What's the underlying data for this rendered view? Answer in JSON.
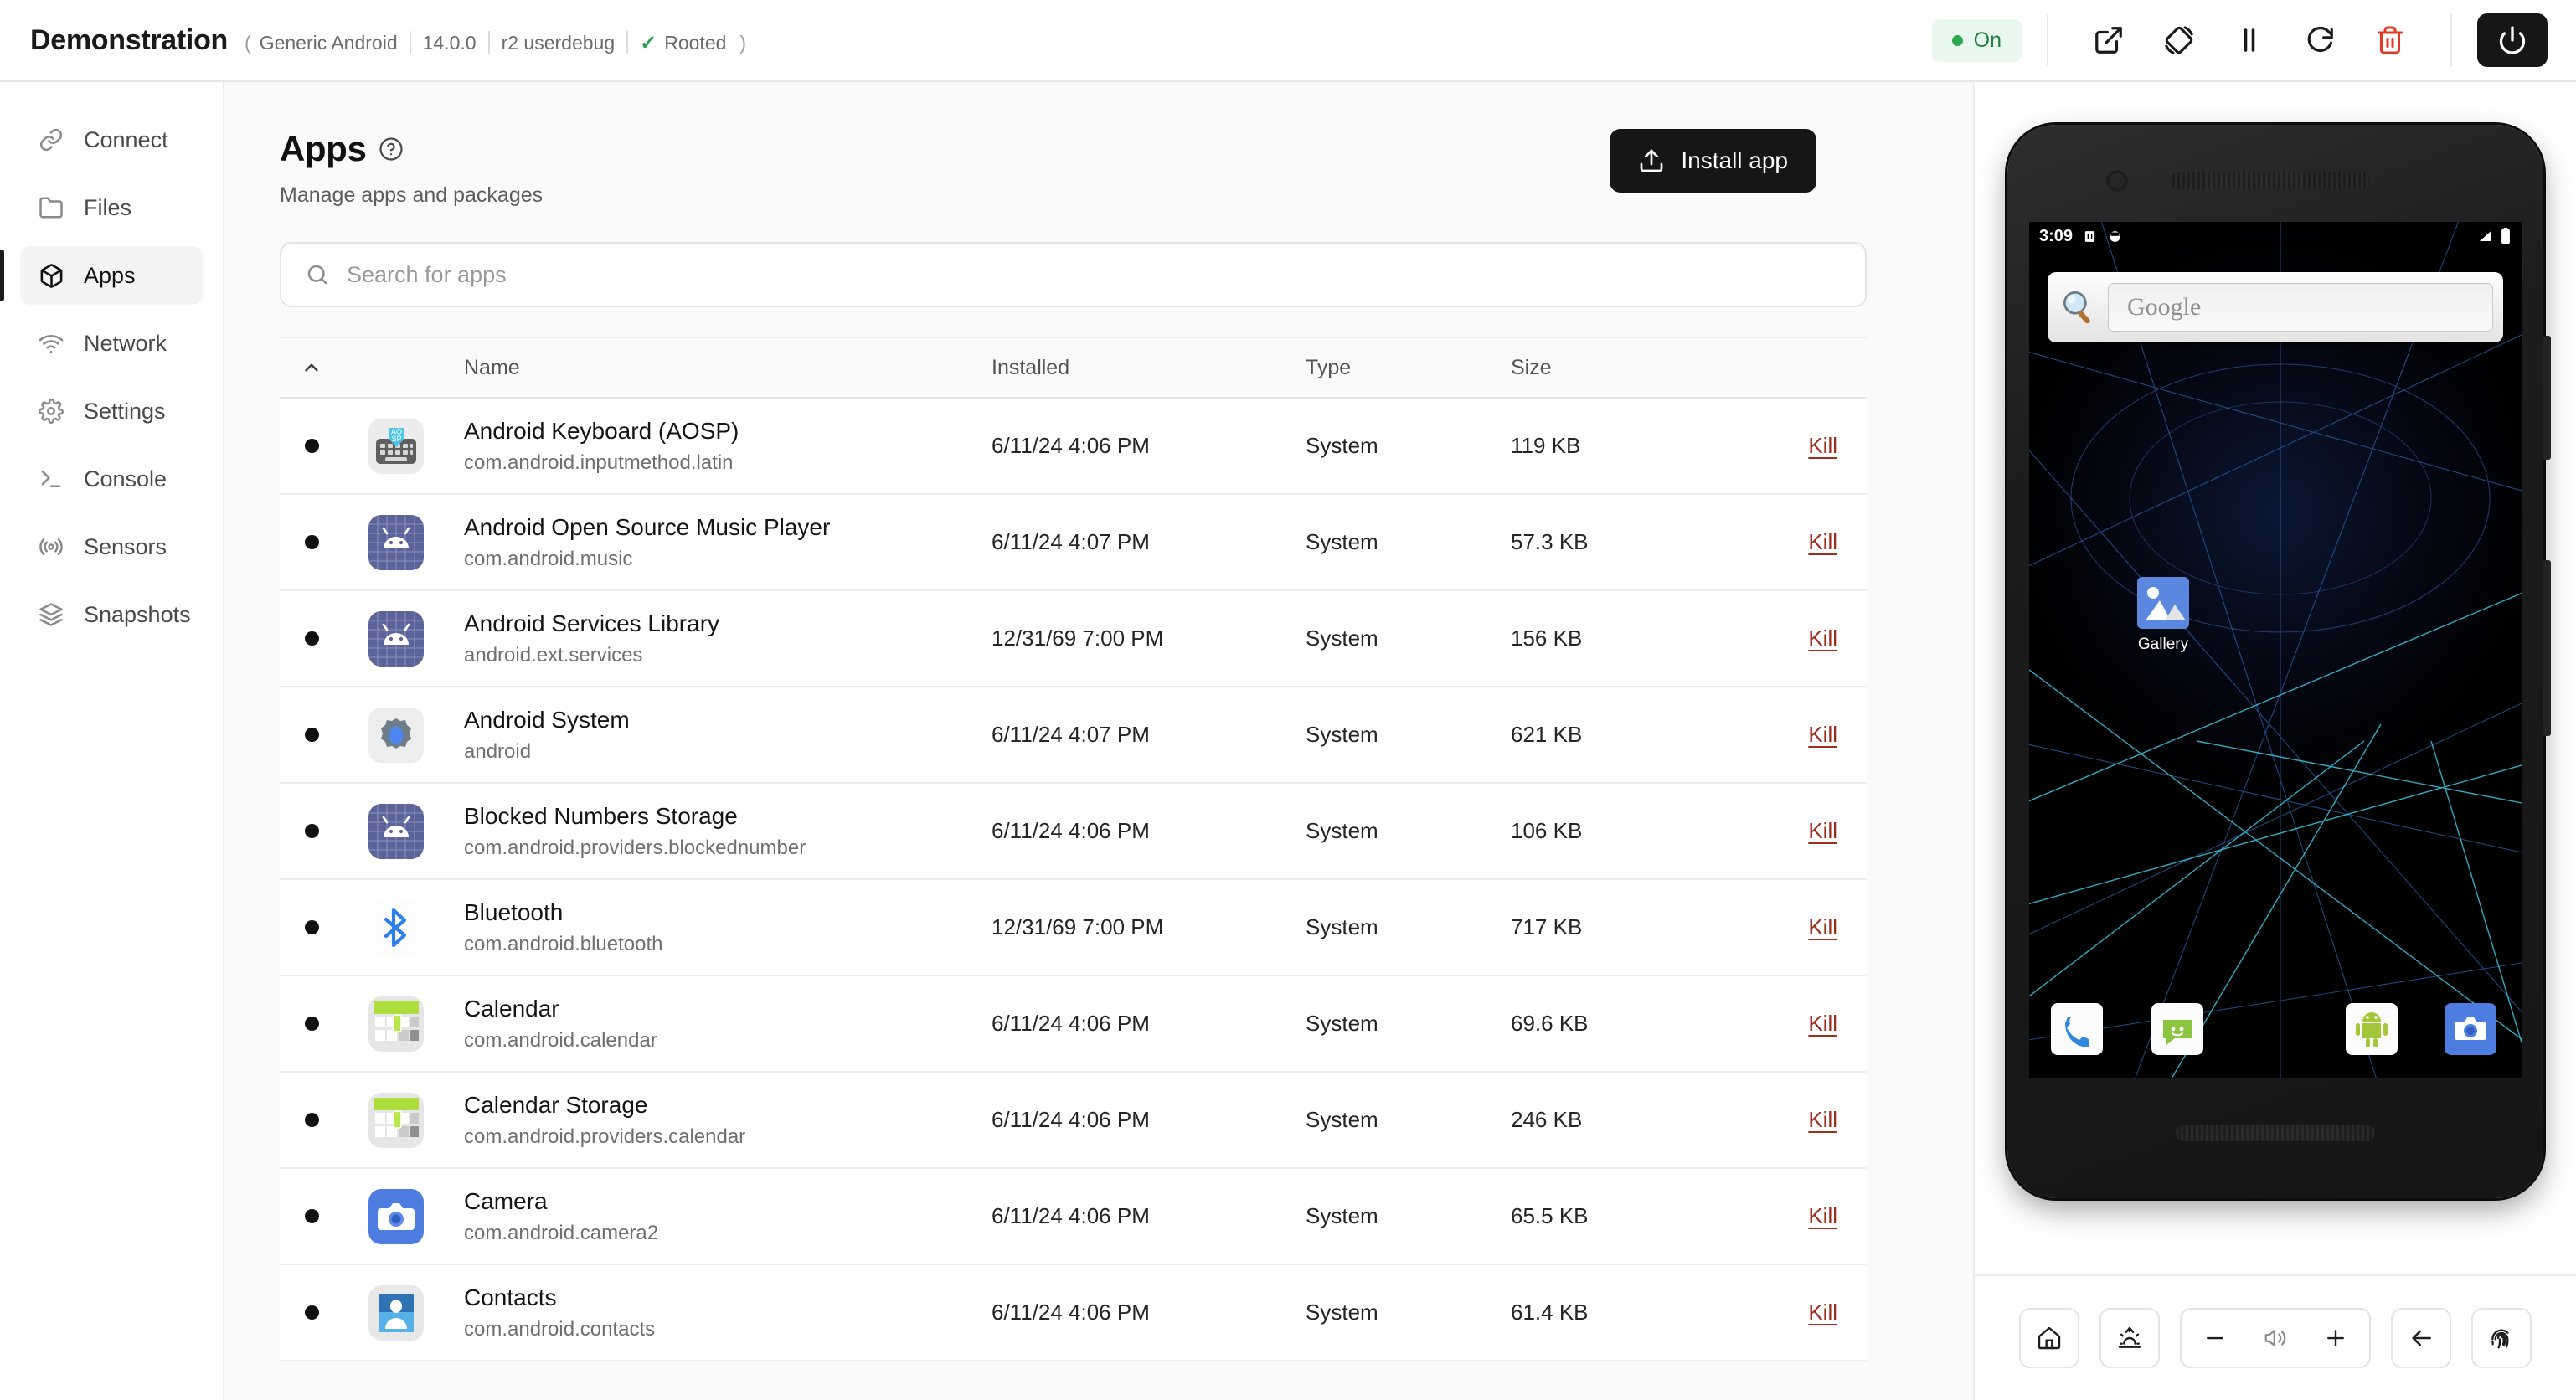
{
  "header": {
    "title": "Demonstration",
    "device": "Generic Android",
    "version": "14.0.0",
    "build": "r2 userdebug",
    "root_status": "Rooted",
    "root_check": "✓",
    "paren_open": "(",
    "paren_close": ")",
    "status_pill": "On",
    "actions": [
      {
        "name": "open-external-button",
        "label": "Open external"
      },
      {
        "name": "rotate-device-button",
        "label": "Rotate"
      },
      {
        "name": "pause-button",
        "label": "Pause"
      },
      {
        "name": "restart-button",
        "label": "Restart"
      },
      {
        "name": "delete-button",
        "label": "Delete"
      }
    ],
    "power_label": "Power",
    "colors": {
      "accent_green": "#2fa84f",
      "danger_red": "#e03a23",
      "dark": "#161616"
    }
  },
  "sidebar": {
    "items": [
      {
        "label": "Connect",
        "icon": "link-icon",
        "active": false
      },
      {
        "label": "Files",
        "icon": "folder-icon",
        "active": false
      },
      {
        "label": "Apps",
        "icon": "box-icon",
        "active": true
      },
      {
        "label": "Network",
        "icon": "wifi-icon",
        "active": false
      },
      {
        "label": "Settings",
        "icon": "gear-icon",
        "active": false
      },
      {
        "label": "Console",
        "icon": "terminal-icon",
        "active": false
      },
      {
        "label": "Sensors",
        "icon": "sensor-icon",
        "active": false
      },
      {
        "label": "Snapshots",
        "icon": "layers-icon",
        "active": false
      }
    ]
  },
  "page": {
    "title": "Apps",
    "subtitle": "Manage apps and packages",
    "install_label": "Install app",
    "search_placeholder": "Search for apps",
    "search_value": ""
  },
  "table": {
    "columns": [
      "",
      "",
      "Name",
      "Installed",
      "Type",
      "Size",
      ""
    ],
    "headers": {
      "name": "Name",
      "installed": "Installed",
      "type": "Type",
      "size": "Size"
    },
    "sort_indicator": "▲",
    "action_label": "Kill",
    "rows": [
      {
        "name": "Android Keyboard (AOSP)",
        "package": "com.android.inputmethod.latin",
        "installed": "6/11/24 4:06 PM",
        "type": "System",
        "size": "119 KB",
        "icon": "keyboard-icon",
        "running": true
      },
      {
        "name": "Android Open Source Music Player",
        "package": "com.android.music",
        "installed": "6/11/24 4:07 PM",
        "type": "System",
        "size": "57.3 KB",
        "icon": "android-icon",
        "running": true
      },
      {
        "name": "Android Services Library",
        "package": "android.ext.services",
        "installed": "12/31/69 7:00 PM",
        "type": "System",
        "size": "156 KB",
        "icon": "android-icon",
        "running": true
      },
      {
        "name": "Android System",
        "package": "android",
        "installed": "6/11/24 4:07 PM",
        "type": "System",
        "size": "621 KB",
        "icon": "gear-app-icon",
        "running": true
      },
      {
        "name": "Blocked Numbers Storage",
        "package": "com.android.providers.blockednumber",
        "installed": "6/11/24 4:06 PM",
        "type": "System",
        "size": "106 KB",
        "icon": "android-icon",
        "running": true
      },
      {
        "name": "Bluetooth",
        "package": "com.android.bluetooth",
        "installed": "12/31/69 7:00 PM",
        "type": "System",
        "size": "717 KB",
        "icon": "bluetooth-icon",
        "running": true
      },
      {
        "name": "Calendar",
        "package": "com.android.calendar",
        "installed": "6/11/24 4:06 PM",
        "type": "System",
        "size": "69.6 KB",
        "icon": "calendar-icon",
        "running": true
      },
      {
        "name": "Calendar Storage",
        "package": "com.android.providers.calendar",
        "installed": "6/11/24 4:06 PM",
        "type": "System",
        "size": "246 KB",
        "icon": "calendar-icon",
        "running": true
      },
      {
        "name": "Camera",
        "package": "com.android.camera2",
        "installed": "6/11/24 4:06 PM",
        "type": "System",
        "size": "65.5 KB",
        "icon": "camera-icon",
        "running": true
      },
      {
        "name": "Contacts",
        "package": "com.android.contacts",
        "installed": "6/11/24 4:06 PM",
        "type": "System",
        "size": "61.4 KB",
        "icon": "contacts-icon",
        "running": true
      }
    ]
  },
  "device": {
    "status_time": "3:09",
    "search_widget_text": "Google",
    "home_icons": [
      {
        "label": "Gallery",
        "icon": "gallery-icon"
      }
    ],
    "dock": [
      {
        "name": "phone-icon"
      },
      {
        "name": "messaging-icon"
      },
      {
        "name": "android-robot-icon"
      },
      {
        "name": "camera-icon"
      }
    ],
    "toolbar": [
      {
        "name": "home-button",
        "label": "Home"
      },
      {
        "name": "brightness-button",
        "label": "Brightness"
      },
      {
        "name": "volume-down-button",
        "label": "Volume down"
      },
      {
        "name": "volume-icon",
        "label": "Volume"
      },
      {
        "name": "volume-up-button",
        "label": "Volume up"
      },
      {
        "name": "back-button",
        "label": "Back"
      },
      {
        "name": "fingerprint-button",
        "label": "Fingerprint"
      }
    ]
  }
}
